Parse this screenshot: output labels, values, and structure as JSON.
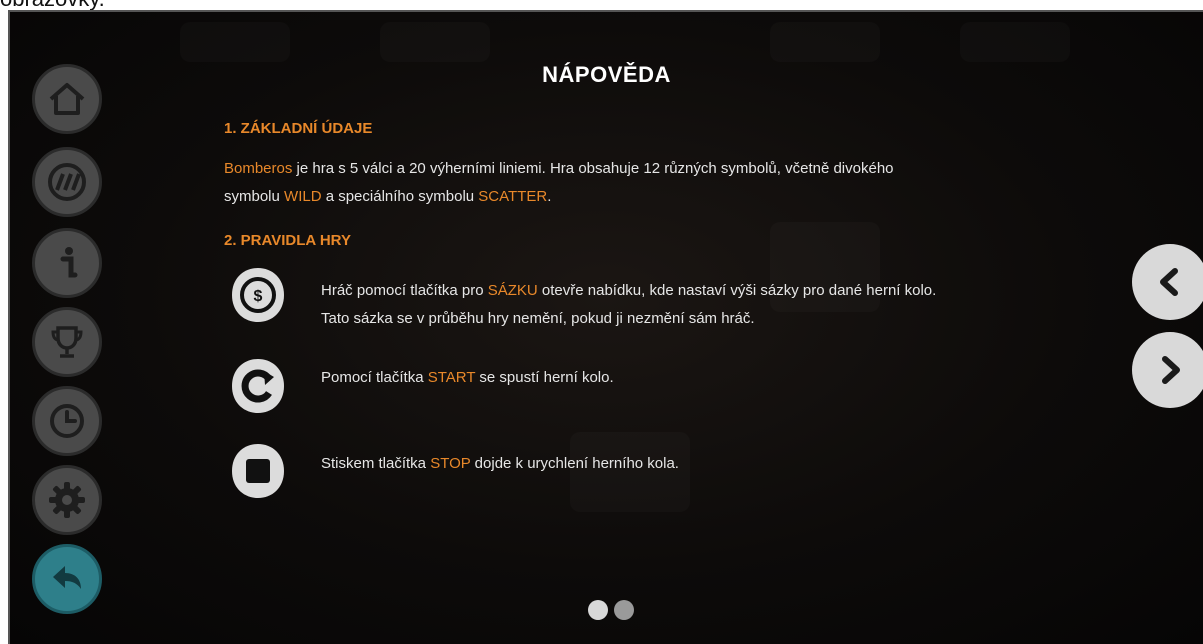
{
  "caption_fragment": "obrazovky.",
  "sidebar": {
    "items": [
      {
        "icon": "home-icon"
      },
      {
        "icon": "paylines-icon"
      },
      {
        "icon": "info-icon"
      },
      {
        "icon": "trophy-icon"
      },
      {
        "icon": "history-icon"
      },
      {
        "icon": "gear-icon"
      },
      {
        "icon": "back-arrow-icon",
        "active": true
      }
    ]
  },
  "page": {
    "title": "NÁPOVĚDA",
    "section1": {
      "heading": "1. ZÁKLADNÍ ÚDAJE",
      "line1_game": "Bomberos",
      "line1_rest": " je hra s 5 válci a 20 výherními liniemi. Hra obsahuje 12 různých symbolů, včetně divokého",
      "line2_pre": "symbolu ",
      "line2_wild": "WILD",
      "line2_mid": " a speciálního symbolu ",
      "line2_scatter": "SCATTER",
      "line2_end": "."
    },
    "section2": {
      "heading": "2. PRAVIDLA HRY",
      "rules": [
        {
          "icon": "bet-coin-icon",
          "pre": "Hráč pomocí tlačítka pro ",
          "keyword": "SÁZKU",
          "post": " otevře nabídku, kde nastaví výši sázky pro dané herní kolo.",
          "line2": "Tato sázka se v průběhu hry nemění, pokud ji nezmění sám hráč."
        },
        {
          "icon": "start-spin-icon",
          "pre": "Pomocí tlačítka ",
          "keyword": "START",
          "post": " se spustí herní kolo.",
          "line2": ""
        },
        {
          "icon": "stop-square-icon",
          "pre": "Stiskem tlačítka ",
          "keyword": "STOP",
          "post": " dojde k urychlení herního kola.",
          "line2": ""
        }
      ]
    }
  },
  "navigation": {
    "prev_icon": "chevron-left-icon",
    "next_icon": "chevron-right-icon"
  },
  "pagination": {
    "pages": 2,
    "current": 1
  },
  "colors": {
    "accent": "#e8882a",
    "active_button": "#2e7f8a",
    "sidebar_button": "#4a4a4a"
  }
}
